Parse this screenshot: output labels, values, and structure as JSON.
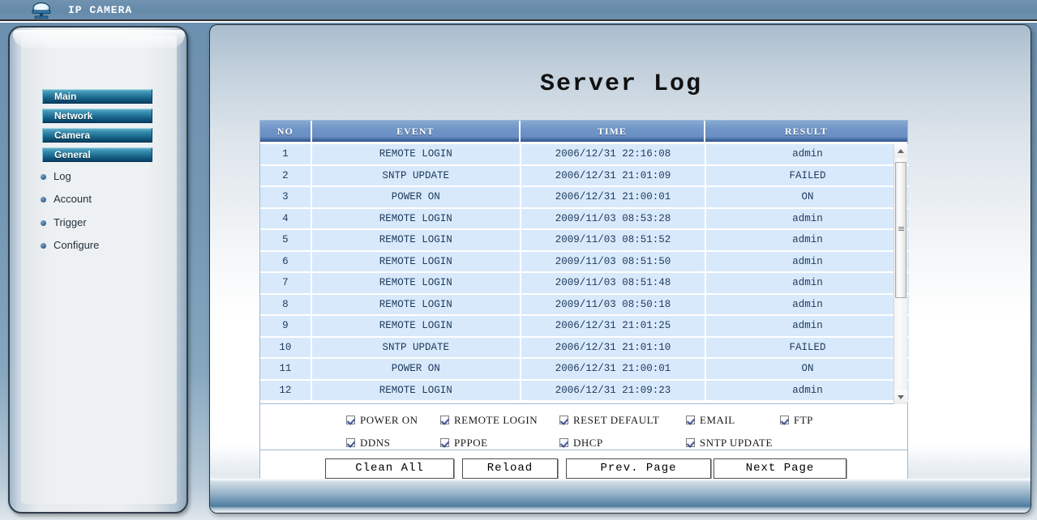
{
  "header": {
    "brand": "IP CAMERA",
    "logo_icon": "ip-camera-icon"
  },
  "sidebar": {
    "nav_buttons": [
      {
        "label": "Main"
      },
      {
        "label": "Network"
      },
      {
        "label": "Camera"
      },
      {
        "label": "General"
      }
    ],
    "sub_items": [
      {
        "label": "Log"
      },
      {
        "label": "Account"
      },
      {
        "label": "Trigger"
      },
      {
        "label": "Configure"
      }
    ]
  },
  "main": {
    "title": "Server Log",
    "table": {
      "columns": [
        "NO",
        "EVENT",
        "TIME",
        "RESULT"
      ],
      "rows": [
        {
          "no": "1",
          "event": "REMOTE LOGIN",
          "time": "2006/12/31 22:16:08",
          "result": "admin"
        },
        {
          "no": "2",
          "event": "SNTP UPDATE",
          "time": "2006/12/31 21:01:09",
          "result": "FAILED"
        },
        {
          "no": "3",
          "event": "POWER ON",
          "time": "2006/12/31 21:00:01",
          "result": "ON"
        },
        {
          "no": "4",
          "event": "REMOTE LOGIN",
          "time": "2009/11/03 08:53:28",
          "result": "admin"
        },
        {
          "no": "5",
          "event": "REMOTE LOGIN",
          "time": "2009/11/03 08:51:52",
          "result": "admin"
        },
        {
          "no": "6",
          "event": "REMOTE LOGIN",
          "time": "2009/11/03 08:51:50",
          "result": "admin"
        },
        {
          "no": "7",
          "event": "REMOTE LOGIN",
          "time": "2009/11/03 08:51:48",
          "result": "admin"
        },
        {
          "no": "8",
          "event": "REMOTE LOGIN",
          "time": "2009/11/03 08:50:18",
          "result": "admin"
        },
        {
          "no": "9",
          "event": "REMOTE LOGIN",
          "time": "2006/12/31 21:01:25",
          "result": "admin"
        },
        {
          "no": "10",
          "event": "SNTP UPDATE",
          "time": "2006/12/31 21:01:10",
          "result": "FAILED"
        },
        {
          "no": "11",
          "event": "POWER ON",
          "time": "2006/12/31 21:00:01",
          "result": "ON"
        },
        {
          "no": "12",
          "event": "REMOTE LOGIN",
          "time": "2006/12/31 21:09:23",
          "result": "admin"
        }
      ]
    },
    "filters": [
      {
        "id": "poweron",
        "label": "POWER ON",
        "checked": true
      },
      {
        "id": "remotelogin",
        "label": "REMOTE LOGIN",
        "checked": true
      },
      {
        "id": "resetdefault",
        "label": "RESET DEFAULT",
        "checked": true
      },
      {
        "id": "email",
        "label": "EMAIL",
        "checked": true
      },
      {
        "id": "ftp",
        "label": "FTP",
        "checked": true
      },
      {
        "id": "ddns",
        "label": "DDNS",
        "checked": true
      },
      {
        "id": "pppoe",
        "label": "PPPOE",
        "checked": true
      },
      {
        "id": "dhcp",
        "label": "DHCP",
        "checked": true
      },
      {
        "id": "sntpupdate",
        "label": "SNTP UPDATE",
        "checked": true
      }
    ],
    "buttons": {
      "clean_all": "Clean All",
      "reload": "Reload",
      "prev_page": "Prev. Page",
      "next_page": "Next Page"
    },
    "scrollbar": {
      "up_icon": "chevron-up-icon",
      "down_icon": "chevron-down-icon"
    }
  },
  "colors": {
    "header_bar": "#6d92b0",
    "nav_button": "#1d6d91",
    "table_header": "#6a90c4",
    "table_row": "#d8e9fb",
    "table_text": "#1d3a5c"
  }
}
